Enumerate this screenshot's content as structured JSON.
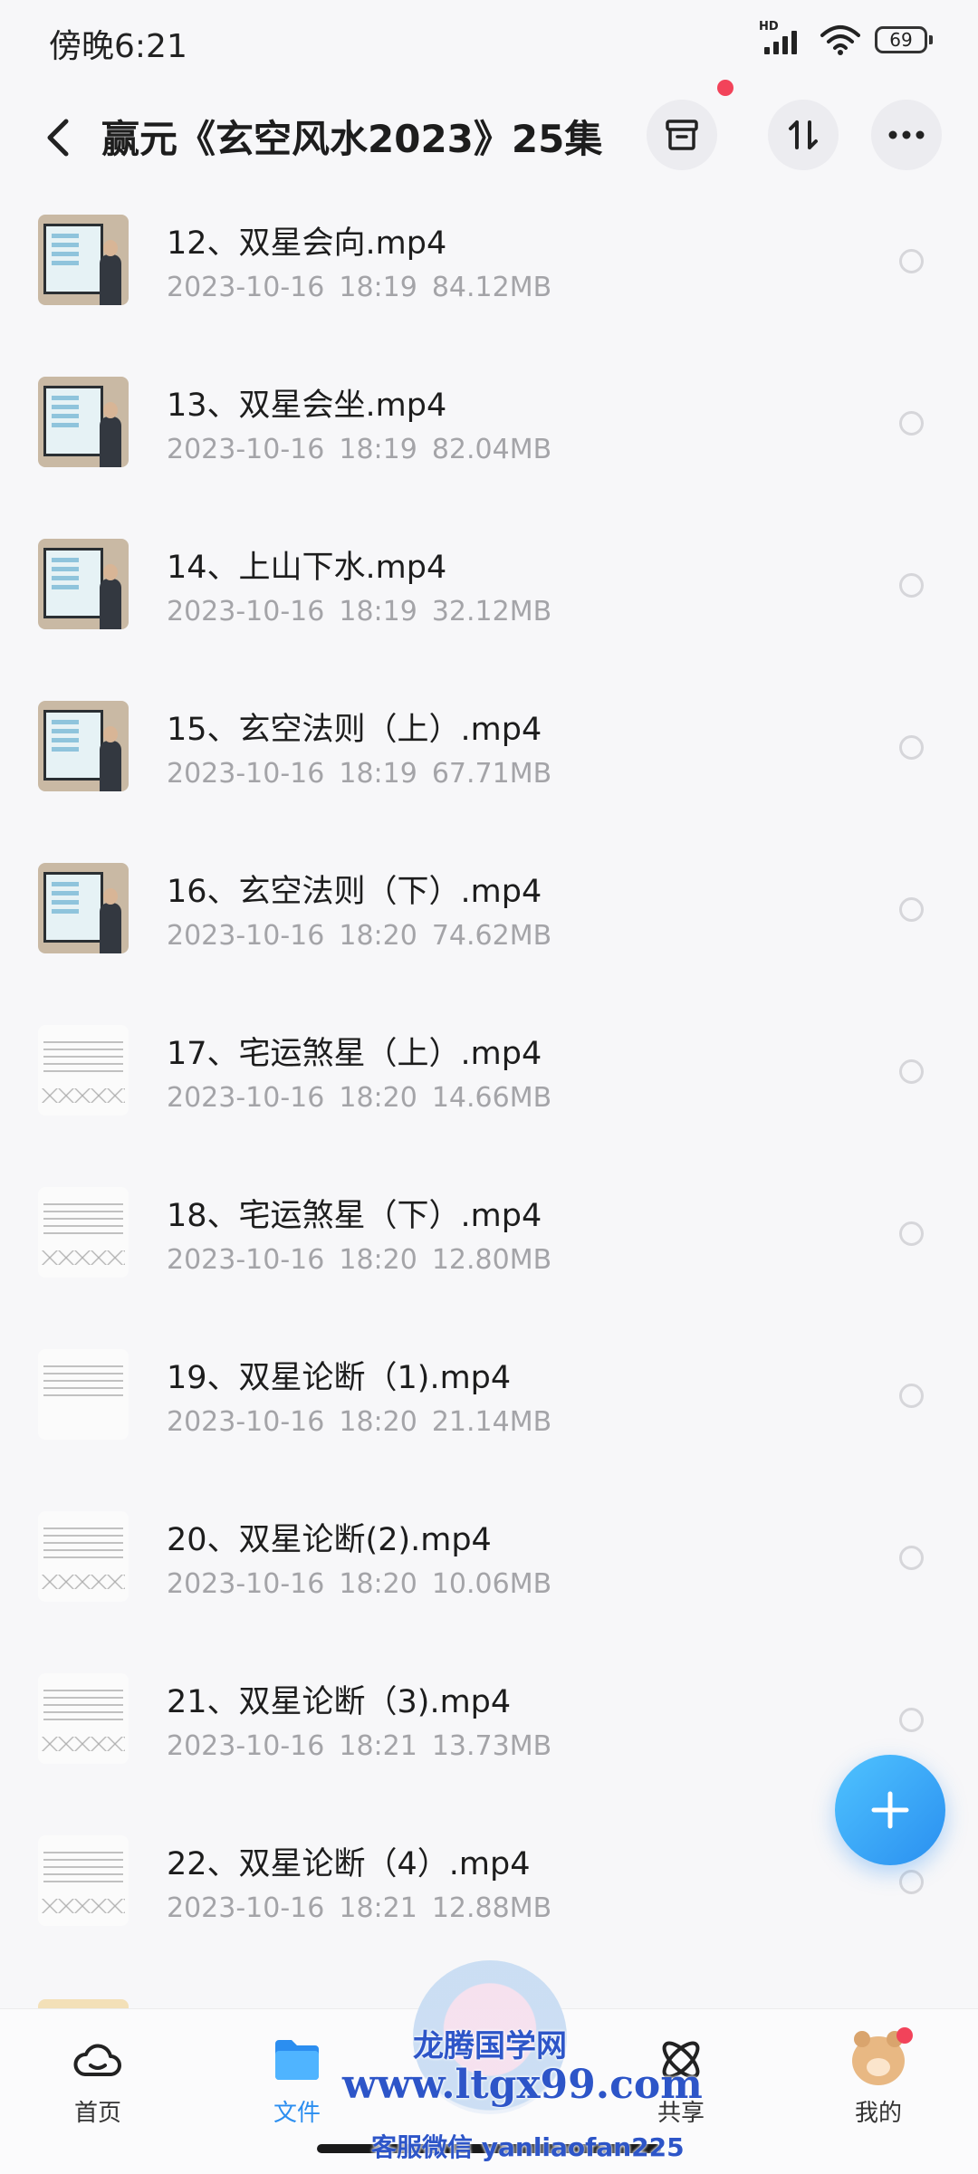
{
  "status_bar": {
    "time": "傍晚6:21",
    "network": "HD",
    "battery": "69"
  },
  "header": {
    "title": "赢元《玄空风水2023》25集"
  },
  "files": [
    {
      "name": "12、双星会向.mp4",
      "date": "2023-10-16",
      "time": "18:19",
      "size": "84.12MB",
      "thumb": "video"
    },
    {
      "name": "13、双星会坐.mp4",
      "date": "2023-10-16",
      "time": "18:19",
      "size": "82.04MB",
      "thumb": "video"
    },
    {
      "name": "14、上山下水.mp4",
      "date": "2023-10-16",
      "time": "18:19",
      "size": "32.12MB",
      "thumb": "video"
    },
    {
      "name": "15、玄空法则（上）.mp4",
      "date": "2023-10-16",
      "time": "18:19",
      "size": "67.71MB",
      "thumb": "video"
    },
    {
      "name": "16、玄空法则（下）.mp4",
      "date": "2023-10-16",
      "time": "18:20",
      "size": "74.62MB",
      "thumb": "video"
    },
    {
      "name": "17、宅运煞星（上）.mp4",
      "date": "2023-10-16",
      "time": "18:20",
      "size": "14.66MB",
      "thumb": "doc"
    },
    {
      "name": "18、宅运煞星（下）.mp4",
      "date": "2023-10-16",
      "time": "18:20",
      "size": "12.80MB",
      "thumb": "doc"
    },
    {
      "name": "19、双星论断（1).mp4",
      "date": "2023-10-16",
      "time": "18:20",
      "size": "21.14MB",
      "thumb": "doc"
    },
    {
      "name": "20、双星论断(2).mp4",
      "date": "2023-10-16",
      "time": "18:20",
      "size": "10.06MB",
      "thumb": "doc"
    },
    {
      "name": "21、双星论断（3).mp4",
      "date": "2023-10-16",
      "time": "18:21",
      "size": "13.73MB",
      "thumb": "doc"
    },
    {
      "name": "22、双星论断（4）.mp4",
      "date": "2023-10-16",
      "time": "18:21",
      "size": "12.88MB",
      "thumb": "doc"
    }
  ],
  "bottom_nav": [
    {
      "label": "首页",
      "icon": "cloud-icon",
      "active": false
    },
    {
      "label": "文件",
      "icon": "folder-icon",
      "active": true
    },
    {
      "label": "共享",
      "icon": "share-atom-icon",
      "active": false
    },
    {
      "label": "我的",
      "icon": "avatar-icon",
      "active": false
    }
  ],
  "watermark": {
    "line1": "龙腾国学网",
    "line2": "www.ltgx99.com",
    "line3": "客服微信 yanliaofan225"
  },
  "colors": {
    "accent": "#2b8ef0",
    "badge": "#f2435a",
    "meta_text": "#a4a4a8"
  }
}
